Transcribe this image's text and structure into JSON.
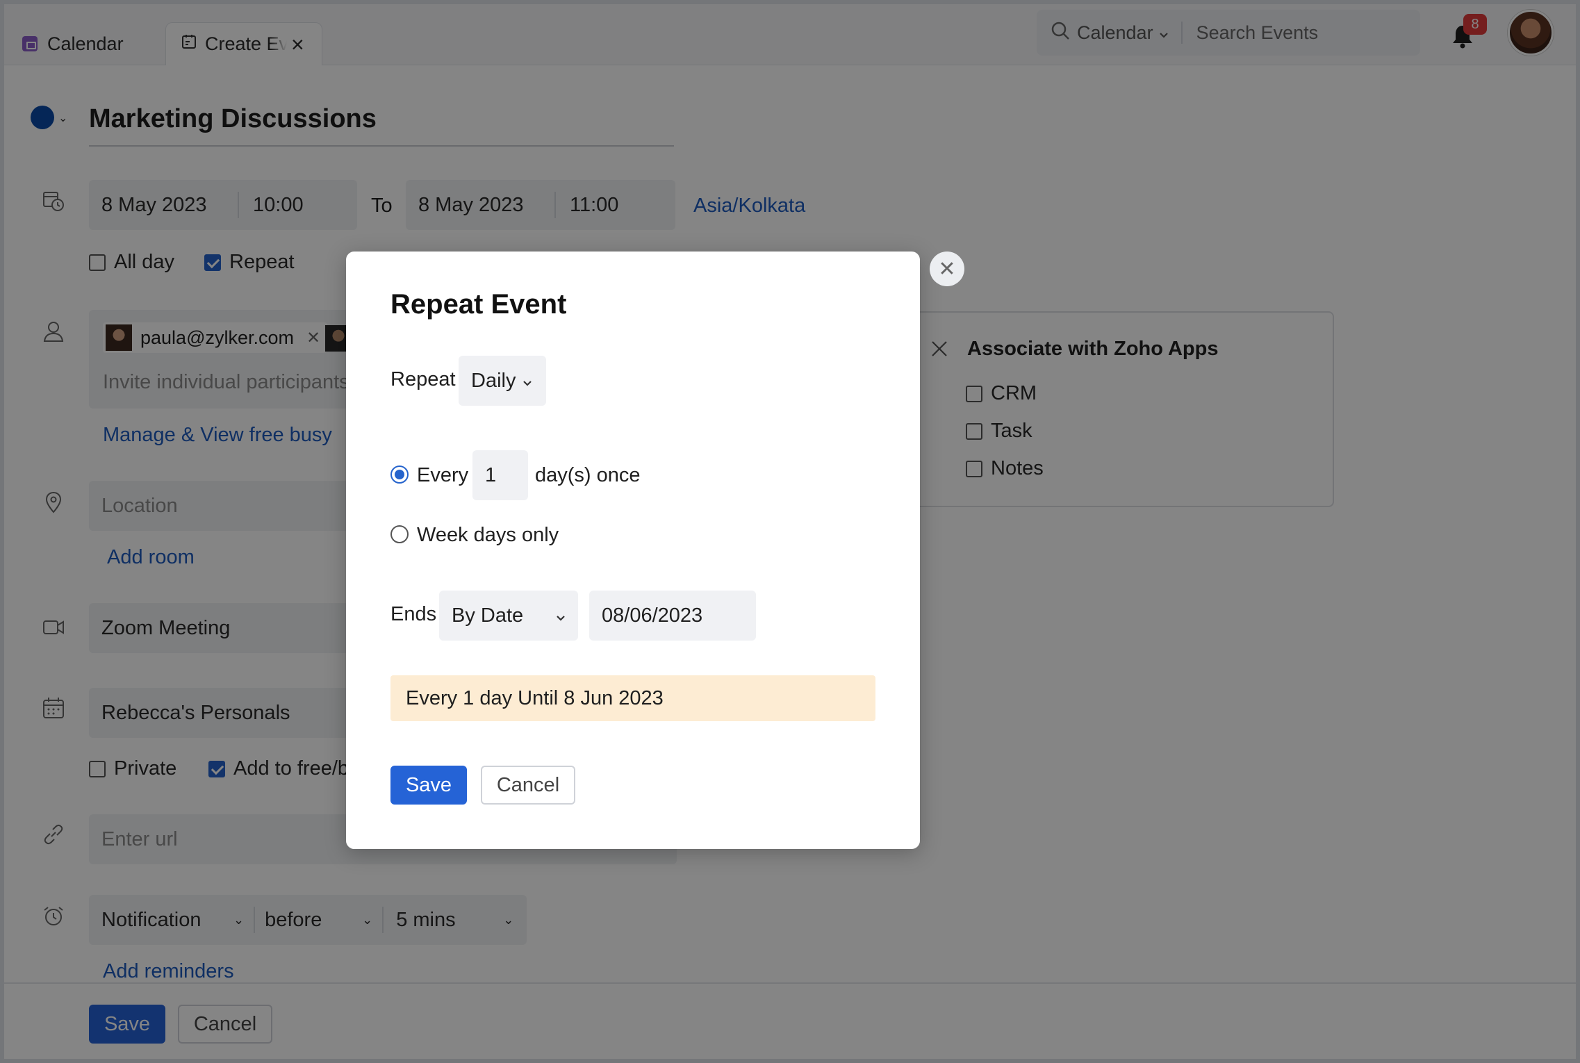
{
  "tabs": [
    {
      "label": "Calendar"
    },
    {
      "label": "Create Event"
    }
  ],
  "search": {
    "scope": "Calendar",
    "placeholder": "Search Events"
  },
  "notifications": {
    "count": "8"
  },
  "event": {
    "title": "Marketing Discussions",
    "start_date": "8 May 2023",
    "start_time": "10:00",
    "to_label": "To",
    "end_date": "8 May 2023",
    "end_time": "11:00",
    "timezone": "Asia/Kolkata",
    "all_day_label": "All day",
    "repeat_label": "Repeat",
    "participant_email": "paula@zylker.com",
    "invite_placeholder": "Invite individual participants",
    "manage_free_busy": "Manage & View free busy",
    "location_placeholder": "Location",
    "add_room": "Add room",
    "meeting": "Zoom Meeting",
    "calendar": "Rebecca's Personals",
    "private_label": "Private",
    "add_free_busy_label": "Add to free/b",
    "url_placeholder": "Enter url",
    "notification_type": "Notification",
    "notification_when": "before",
    "notification_time": "5 mins",
    "add_reminders": "Add reminders",
    "save": "Save",
    "cancel": "Cancel"
  },
  "associate": {
    "title": "Associate with Zoho Apps",
    "items": [
      {
        "label": "CRM"
      },
      {
        "label": "Task"
      },
      {
        "label": "Notes"
      }
    ]
  },
  "repeat_modal": {
    "title": "Repeat Event",
    "repeat_label": "Repeat",
    "repeat_value": "Daily",
    "every_label": "Every",
    "every_value": "1",
    "every_suffix": "day(s) once",
    "weekdays_label": "Week days only",
    "ends_label": "Ends",
    "ends_value": "By Date",
    "ends_date": "08/06/2023",
    "summary": "Every 1 day Until 8 Jun 2023",
    "save": "Save",
    "cancel": "Cancel"
  },
  "colors": {
    "accent": "#2563d6",
    "event_color": "#0a4aa8",
    "summary_bg": "#fdecd3"
  }
}
